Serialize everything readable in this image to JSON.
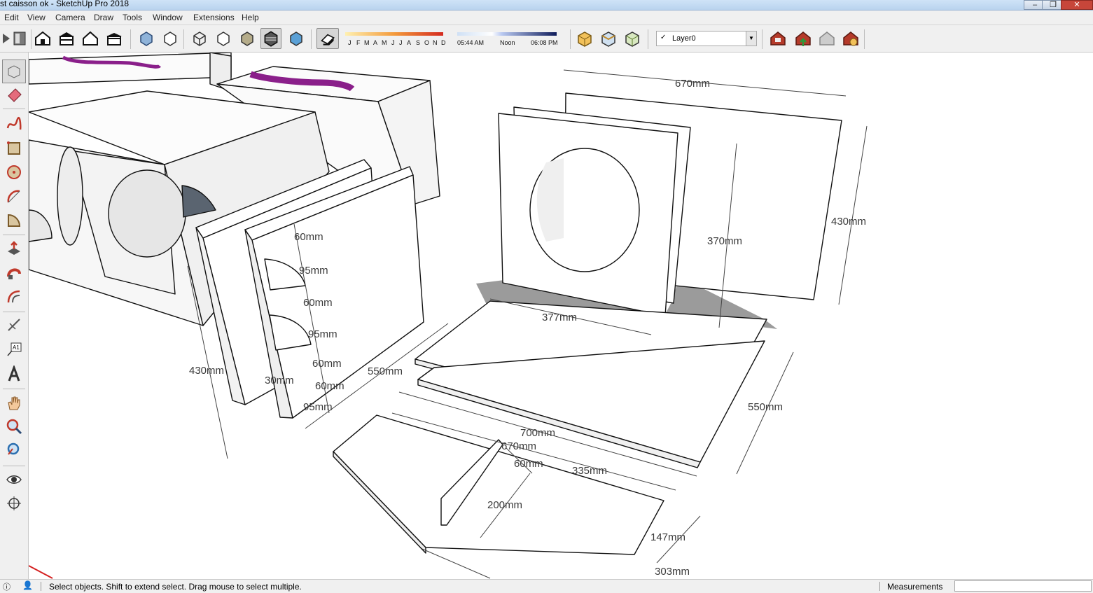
{
  "window": {
    "title": "st caisson ok - SketchUp Pro 2018",
    "buttons": [
      "–",
      "❐",
      "✕"
    ]
  },
  "menu": [
    "Edit",
    "View",
    "Camera",
    "Draw",
    "Tools",
    "Window",
    "Extensions",
    "Help"
  ],
  "toolbar": {
    "views": [
      "iso-view-icon",
      "top-view-icon",
      "front-view-icon",
      "right-view-icon",
      "back-view-icon",
      "left-view-icon"
    ],
    "styles": [
      "xray-icon",
      "wireframe-icon",
      "hidden-line-icon",
      "shaded-icon",
      "shaded-textures-icon",
      "monochrome-icon"
    ],
    "shadows": {
      "months": [
        "J",
        "F",
        "M",
        "A",
        "M",
        "J",
        "J",
        "A",
        "S",
        "O",
        "N",
        "D"
      ],
      "time_start": "05:44 AM",
      "time_mid": "Noon",
      "time_end": "06:08 PM"
    },
    "layer": {
      "check": "✓",
      "name": "Layer0"
    }
  },
  "dimensions": {
    "d670_top": "670mm",
    "d430_right": "430mm",
    "d370": "370mm",
    "d377": "377mm",
    "d550_right": "550mm",
    "d700": "700mm",
    "d670_mid": "670mm",
    "d60_bottom": "60mm",
    "d335": "335mm",
    "d200": "200mm",
    "d147": "147mm",
    "d303": "303mm",
    "d60_a": "60mm",
    "d95_a": "95mm",
    "d60_b": "60mm",
    "d95_b": "95mm",
    "d60_c": "60mm",
    "d60_d": "60mm",
    "d95_c": "95mm",
    "d430_left": "430mm",
    "d30": "30mm",
    "d550_left": "550mm"
  },
  "status": {
    "message": "Select objects. Shift to extend select. Drag mouse to select multiple.",
    "measurements_label": "Measurements",
    "measurements_value": ""
  }
}
